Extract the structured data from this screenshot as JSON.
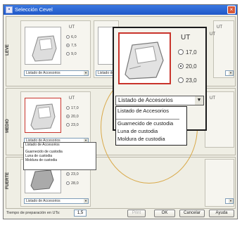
{
  "window": {
    "title": "Selección Cevel",
    "close_label": "×",
    "icon_glyph": "▪"
  },
  "levels": [
    {
      "label": "LEVE",
      "ut_header": "UT",
      "options": [
        "6,0",
        "7,5",
        "9,0"
      ],
      "selected_index": 1,
      "combo_value": "Listado de Accesorios",
      "combo_value_2": "Listado de"
    },
    {
      "label": "MEDIO",
      "ut_header": "UT",
      "options": [
        "17,0",
        "20,0",
        "23,0"
      ],
      "selected_index": 1,
      "combo_value": "Listado de Accesorios",
      "extra_ut": "UT"
    },
    {
      "label": "FUERTE",
      "options": [
        "23,0",
        "28,0"
      ],
      "selected_index": 0,
      "combo_value": "Listado de Accesorios"
    }
  ],
  "small_dropdown_list": [
    "Listado de Accesorios",
    "Guarnecido de custodia",
    "Luna de custodia",
    "Moldura de custodia"
  ],
  "zoom": {
    "ut_header": "UT",
    "options": [
      "17,0",
      "20,0",
      "23,0"
    ],
    "selected_index": 1,
    "combo_value": "Listado de Accesorios",
    "list_items": [
      "Listado de Accesorios",
      "Guarnecido de custodia",
      "Luna de custodia",
      "Moldura de custodia"
    ],
    "right_header": "UT"
  },
  "footer": {
    "prep_label": "Tiempo de preparación en UTs:",
    "prep_value": "1,5",
    "buttons": {
      "print": "Print",
      "ok": "OK",
      "cancel": "Cancelar",
      "help": "Ayuda"
    }
  },
  "colors": {
    "selection_border": "#c9342c",
    "annotation_ellipse": "#d9a94a",
    "titlebar": "#2a60d0"
  }
}
